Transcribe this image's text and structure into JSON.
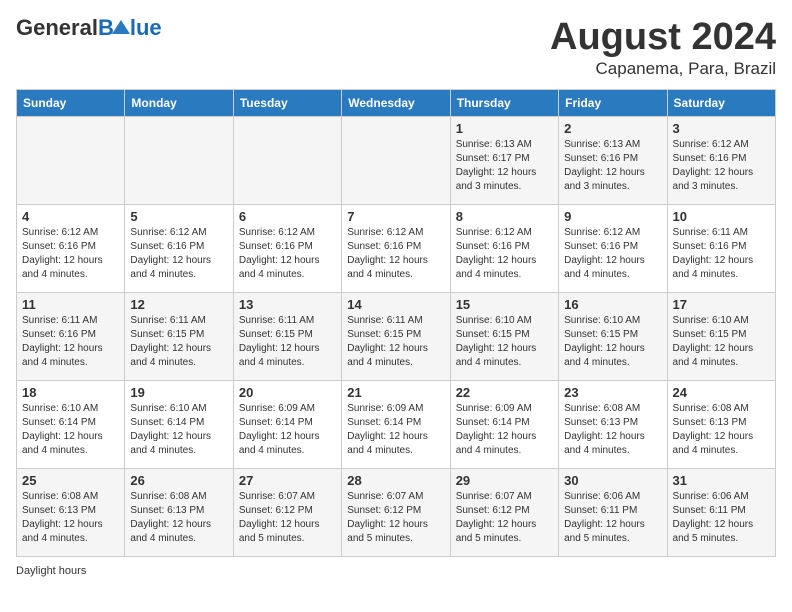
{
  "header": {
    "logo_line1": "General",
    "logo_line2": "Blue",
    "title": "August 2024",
    "subtitle": "Capanema, Para, Brazil"
  },
  "days_of_week": [
    "Sunday",
    "Monday",
    "Tuesday",
    "Wednesday",
    "Thursday",
    "Friday",
    "Saturday"
  ],
  "weeks": [
    [
      {
        "day": "",
        "info": ""
      },
      {
        "day": "",
        "info": ""
      },
      {
        "day": "",
        "info": ""
      },
      {
        "day": "",
        "info": ""
      },
      {
        "day": "1",
        "info": "Sunrise: 6:13 AM\nSunset: 6:17 PM\nDaylight: 12 hours and 3 minutes."
      },
      {
        "day": "2",
        "info": "Sunrise: 6:13 AM\nSunset: 6:16 PM\nDaylight: 12 hours and 3 minutes."
      },
      {
        "day": "3",
        "info": "Sunrise: 6:12 AM\nSunset: 6:16 PM\nDaylight: 12 hours and 3 minutes."
      }
    ],
    [
      {
        "day": "4",
        "info": "Sunrise: 6:12 AM\nSunset: 6:16 PM\nDaylight: 12 hours and 4 minutes."
      },
      {
        "day": "5",
        "info": "Sunrise: 6:12 AM\nSunset: 6:16 PM\nDaylight: 12 hours and 4 minutes."
      },
      {
        "day": "6",
        "info": "Sunrise: 6:12 AM\nSunset: 6:16 PM\nDaylight: 12 hours and 4 minutes."
      },
      {
        "day": "7",
        "info": "Sunrise: 6:12 AM\nSunset: 6:16 PM\nDaylight: 12 hours and 4 minutes."
      },
      {
        "day": "8",
        "info": "Sunrise: 6:12 AM\nSunset: 6:16 PM\nDaylight: 12 hours and 4 minutes."
      },
      {
        "day": "9",
        "info": "Sunrise: 6:12 AM\nSunset: 6:16 PM\nDaylight: 12 hours and 4 minutes."
      },
      {
        "day": "10",
        "info": "Sunrise: 6:11 AM\nSunset: 6:16 PM\nDaylight: 12 hours and 4 minutes."
      }
    ],
    [
      {
        "day": "11",
        "info": "Sunrise: 6:11 AM\nSunset: 6:16 PM\nDaylight: 12 hours and 4 minutes."
      },
      {
        "day": "12",
        "info": "Sunrise: 6:11 AM\nSunset: 6:15 PM\nDaylight: 12 hours and 4 minutes."
      },
      {
        "day": "13",
        "info": "Sunrise: 6:11 AM\nSunset: 6:15 PM\nDaylight: 12 hours and 4 minutes."
      },
      {
        "day": "14",
        "info": "Sunrise: 6:11 AM\nSunset: 6:15 PM\nDaylight: 12 hours and 4 minutes."
      },
      {
        "day": "15",
        "info": "Sunrise: 6:10 AM\nSunset: 6:15 PM\nDaylight: 12 hours and 4 minutes."
      },
      {
        "day": "16",
        "info": "Sunrise: 6:10 AM\nSunset: 6:15 PM\nDaylight: 12 hours and 4 minutes."
      },
      {
        "day": "17",
        "info": "Sunrise: 6:10 AM\nSunset: 6:15 PM\nDaylight: 12 hours and 4 minutes."
      }
    ],
    [
      {
        "day": "18",
        "info": "Sunrise: 6:10 AM\nSunset: 6:14 PM\nDaylight: 12 hours and 4 minutes."
      },
      {
        "day": "19",
        "info": "Sunrise: 6:10 AM\nSunset: 6:14 PM\nDaylight: 12 hours and 4 minutes."
      },
      {
        "day": "20",
        "info": "Sunrise: 6:09 AM\nSunset: 6:14 PM\nDaylight: 12 hours and 4 minutes."
      },
      {
        "day": "21",
        "info": "Sunrise: 6:09 AM\nSunset: 6:14 PM\nDaylight: 12 hours and 4 minutes."
      },
      {
        "day": "22",
        "info": "Sunrise: 6:09 AM\nSunset: 6:14 PM\nDaylight: 12 hours and 4 minutes."
      },
      {
        "day": "23",
        "info": "Sunrise: 6:08 AM\nSunset: 6:13 PM\nDaylight: 12 hours and 4 minutes."
      },
      {
        "day": "24",
        "info": "Sunrise: 6:08 AM\nSunset: 6:13 PM\nDaylight: 12 hours and 4 minutes."
      }
    ],
    [
      {
        "day": "25",
        "info": "Sunrise: 6:08 AM\nSunset: 6:13 PM\nDaylight: 12 hours and 4 minutes."
      },
      {
        "day": "26",
        "info": "Sunrise: 6:08 AM\nSunset: 6:13 PM\nDaylight: 12 hours and 4 minutes."
      },
      {
        "day": "27",
        "info": "Sunrise: 6:07 AM\nSunset: 6:12 PM\nDaylight: 12 hours and 5 minutes."
      },
      {
        "day": "28",
        "info": "Sunrise: 6:07 AM\nSunset: 6:12 PM\nDaylight: 12 hours and 5 minutes."
      },
      {
        "day": "29",
        "info": "Sunrise: 6:07 AM\nSunset: 6:12 PM\nDaylight: 12 hours and 5 minutes."
      },
      {
        "day": "30",
        "info": "Sunrise: 6:06 AM\nSunset: 6:11 PM\nDaylight: 12 hours and 5 minutes."
      },
      {
        "day": "31",
        "info": "Sunrise: 6:06 AM\nSunset: 6:11 PM\nDaylight: 12 hours and 5 minutes."
      }
    ]
  ],
  "footer": {
    "daylight_hours": "Daylight hours"
  }
}
